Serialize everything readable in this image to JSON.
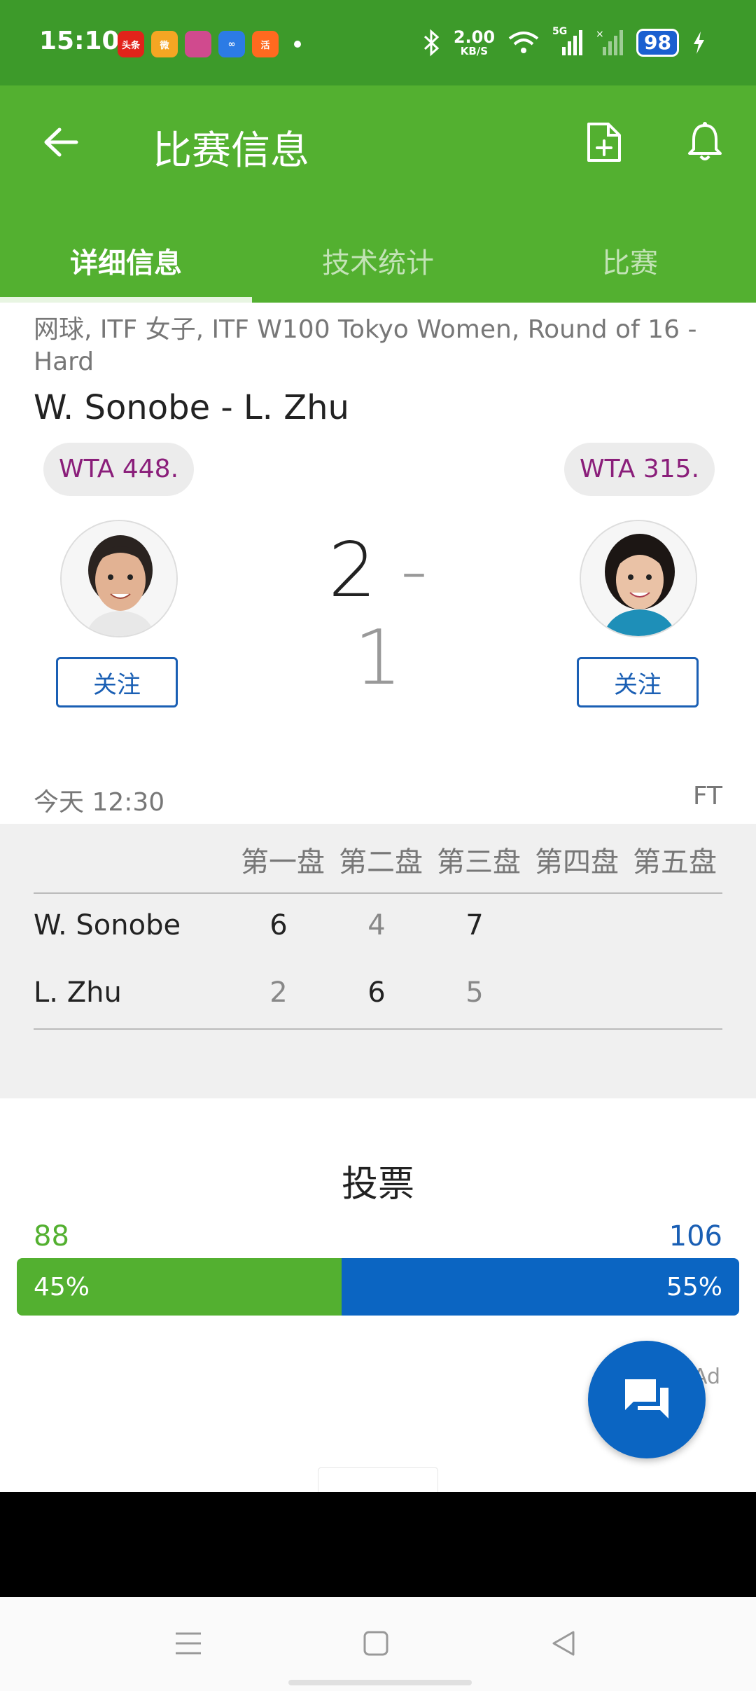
{
  "status_bar": {
    "time": "15:10",
    "apps": [
      {
        "icon": "toutiao-app-icon",
        "label": "头条",
        "color": "#e2231a"
      },
      {
        "icon": "weibo-app-icon",
        "label": "微",
        "color": "#f5a623"
      },
      {
        "icon": "game-app-icon",
        "label": "",
        "color": "#d04a8e"
      },
      {
        "icon": "cloud-app-icon",
        "label": "∞",
        "color": "#2c7be5"
      },
      {
        "icon": "shop-app-icon",
        "label": "活",
        "color": "#ff6a1f"
      }
    ],
    "net_speed_value": "2.00",
    "net_speed_unit": "KB/S",
    "network": "5G",
    "battery": "98"
  },
  "app_bar": {
    "title": "比赛信息",
    "tabs": [
      {
        "label": "详细信息",
        "active": true
      },
      {
        "label": "技术统计",
        "active": false
      },
      {
        "label": "比赛",
        "active": false
      }
    ]
  },
  "match": {
    "subtitle": "网球, ITF 女子, ITF W100 Tokyo Women, Round of 16 - Hard",
    "title": "W. Sonobe - L. Zhu",
    "home": {
      "rank": "WTA 448.",
      "follow_label": "关注"
    },
    "away": {
      "rank": "WTA 315.",
      "follow_label": "关注"
    },
    "score_home": "2",
    "score_sep": "-",
    "score_away": "1",
    "time": "今天 12:30",
    "status": "FT"
  },
  "sets": {
    "headers": [
      "第一盘",
      "第二盘",
      "第三盘",
      "第四盘",
      "第五盘"
    ],
    "rows": [
      {
        "player": "W. Sonobe",
        "scores": [
          "6",
          "4",
          "7"
        ],
        "win": [
          true,
          false,
          true
        ]
      },
      {
        "player": "L. Zhu",
        "scores": [
          "2",
          "6",
          "5"
        ],
        "win": [
          false,
          true,
          false
        ]
      }
    ]
  },
  "vote": {
    "title": "投票",
    "home_count": "88",
    "away_count": "106",
    "home_percent": "45%",
    "away_percent": "55%",
    "home_fraction": 0.45
  },
  "ad": {
    "label": "Ad"
  },
  "colors": {
    "status_bar": "#3d9a2a",
    "brand_green": "#53b030",
    "brand_blue": "#0b65c2",
    "rank_text": "#8a1e7a"
  }
}
